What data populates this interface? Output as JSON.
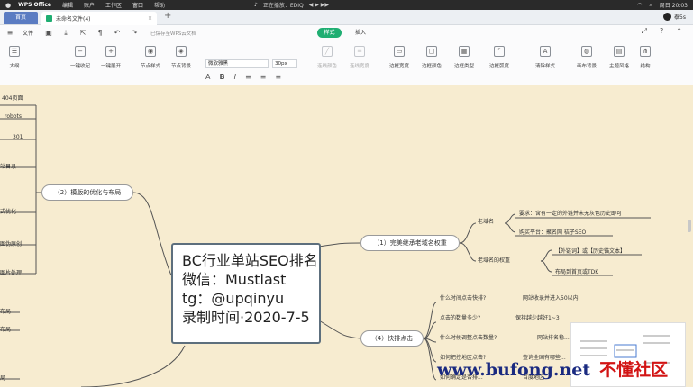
{
  "menubar": {
    "app": "WPS Office",
    "items": [
      "编辑",
      "账户",
      "工作区",
      "窗口",
      "帮助"
    ],
    "media": "正在播放：EDIQ",
    "time": "周日 20:03"
  },
  "tabs": {
    "home": "首页",
    "doc": "未命名文件(4)",
    "user": "泰5s"
  },
  "quickbar": {
    "file": "文件",
    "saved": "已保存至WPS云文档",
    "tab_style": "样式",
    "tab_insert": "插入"
  },
  "ribbon": {
    "outline": "大纲",
    "collapse_all": "一键收起",
    "expand_all": "一键展开",
    "node_style": "节点样式",
    "node_bg": "节点背景",
    "font": "微软雅黑",
    "size": "30px",
    "line_color": "连线颜色",
    "line_width": "连线宽度",
    "border_width": "边框宽度",
    "border_color": "边框颜色",
    "border_type": "边框类型",
    "border_radius": "边框弧度",
    "clear_format": "清除样式",
    "canvas_bg": "画布背景",
    "theme": "主题风格",
    "structure": "结构"
  },
  "mindmap": {
    "central": [
      "BC行业单站SEO排名",
      "微信：Mustlast",
      "tg：@upqinyu",
      "录制时间·2020-7-5"
    ],
    "left_branch": "（2）模版的优化与布局",
    "left_items": [
      "404页面",
      "robots",
      "301",
      "站目录",
      "式优化",
      "图伪原创",
      "图片处理",
      "布局",
      "布局",
      "局"
    ],
    "branch1": "（1）完美继承老域名权重",
    "branch1_sub": [
      "老域名",
      "老域名的权重"
    ],
    "branch1_leaves": [
      "要求：含有一定的外链并未无灰色历史即可",
      "购买平台：聚名网 桔子SEO",
      "【外链词】或【历史锚文本】",
      "布局到首页或TDK"
    ],
    "branch4": "（4）快排点击",
    "branch4_items": [
      "什么时间点击快排?",
      "点击的数量多少?",
      "什么时候调整点击数量?",
      "如何把控地区点击?",
      "如何确定是否排..."
    ],
    "branch4_leaves": [
      "网站收录并进入50以内",
      "保持越少越好1~3",
      "网站排名稳...",
      "查询全国有哪些...",
      "百度地区..."
    ]
  },
  "watermark": {
    "site": "www.bufong.net",
    "tag": "不懂社区"
  }
}
